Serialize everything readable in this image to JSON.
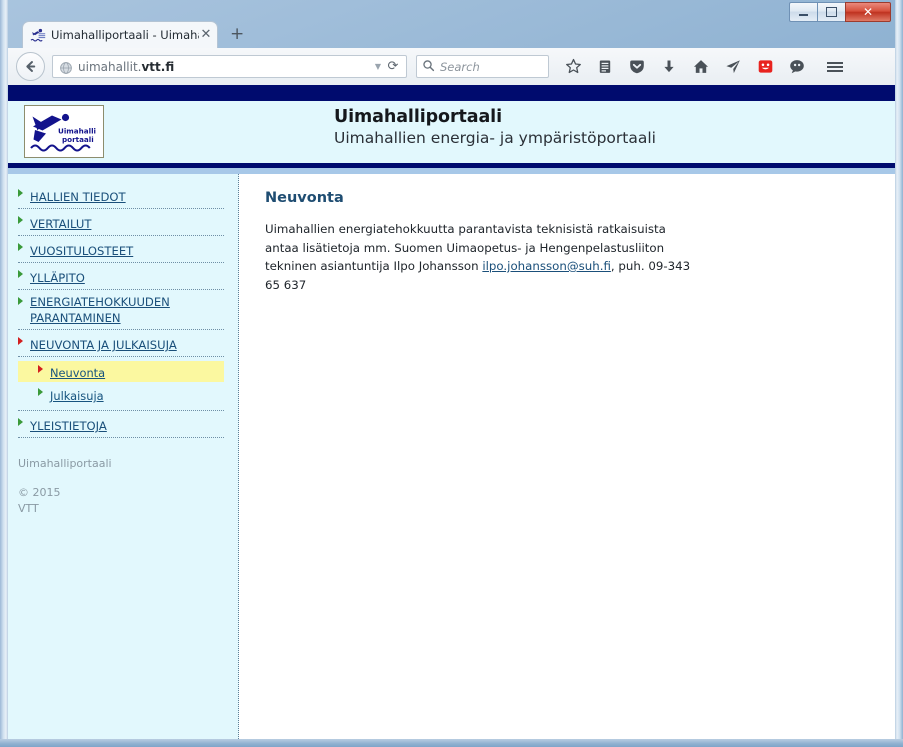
{
  "window": {
    "minimize_label": "Minimize",
    "maximize_label": "Maximize",
    "close_label": "✕"
  },
  "browser": {
    "tab": {
      "title": "Uimahalliportaali - Uimaha...",
      "close_label": "✕",
      "favicon_name": "swimmer-favicon"
    },
    "new_tab_label": "+",
    "back_label": "❮",
    "url": {
      "prefix": "uimahallit.",
      "domain": "vtt.fi",
      "full": "uimahallit.vtt.fi",
      "dropdown_label": "▼",
      "reload_label": "⟳"
    },
    "search": {
      "placeholder": "Search",
      "icon_label": "⚲"
    },
    "toolbar_icons": [
      {
        "name": "bookmark-star-icon",
        "glyph": "☆"
      },
      {
        "name": "reading-list-icon",
        "glyph": "▤"
      },
      {
        "name": "pocket-icon",
        "glyph": "⛉"
      },
      {
        "name": "downloads-icon",
        "glyph": "⬇"
      },
      {
        "name": "home-icon",
        "glyph": "⌂"
      },
      {
        "name": "share-icon",
        "glyph": "➤"
      },
      {
        "name": "smiley-icon",
        "glyph": "☺"
      },
      {
        "name": "chat-bubble-icon",
        "glyph": "💬"
      }
    ],
    "menu_label": "≡"
  },
  "site": {
    "logo": {
      "line1": "Uimahalli",
      "line2": "portaali"
    },
    "title": "Uimahalliportaali",
    "subtitle": "Uimahallien energia- ja ympäristöportaali"
  },
  "sidebar": {
    "items": [
      {
        "label": "HALLIEN TIEDOT",
        "arrow": "green"
      },
      {
        "label": "VERTAILUT",
        "arrow": "green"
      },
      {
        "label": "VUOSITULOSTEET",
        "arrow": "green"
      },
      {
        "label": "YLLÄPITO",
        "arrow": "green"
      },
      {
        "label": "ENERGIATEHOKKUUDEN PARANTAMINEN",
        "arrow": "green"
      },
      {
        "label": "NEUVONTA JA JULKAISUJA",
        "arrow": "red"
      }
    ],
    "subitems": [
      {
        "label": "Neuvonta",
        "arrow": "red",
        "active": true
      },
      {
        "label": "Julkaisuja",
        "arrow": "green",
        "active": false
      }
    ],
    "last_item": {
      "label": "YLEISTIETOJA",
      "arrow": "green"
    },
    "footer": {
      "site_name": "Uimahalliportaali",
      "copyright": "© 2015",
      "organization": "VTT"
    }
  },
  "content": {
    "heading": "Neuvonta",
    "paragraph_part1": "Uimahallien energiatehokkuutta parantavista teknisistä ratkaisuista antaa lisätietoja mm. Suomen Uimaopetus- ja Hengenpelastusliiton tekninen asiantuntija Ilpo Johansson ",
    "email_link": "ilpo.johansson@suh.fi",
    "paragraph_part2": ", puh. 09-343 65 637"
  },
  "colors": {
    "navy_band": "#000b6e",
    "header_bg": "#e2f8fd",
    "light_blue_band": "#a7c8e8",
    "link": "#1a4f7a",
    "heading": "#1f4d72",
    "highlight": "#fbf8a0",
    "arrow_green": "#3a9a3a",
    "arrow_red": "#d21f1f"
  }
}
